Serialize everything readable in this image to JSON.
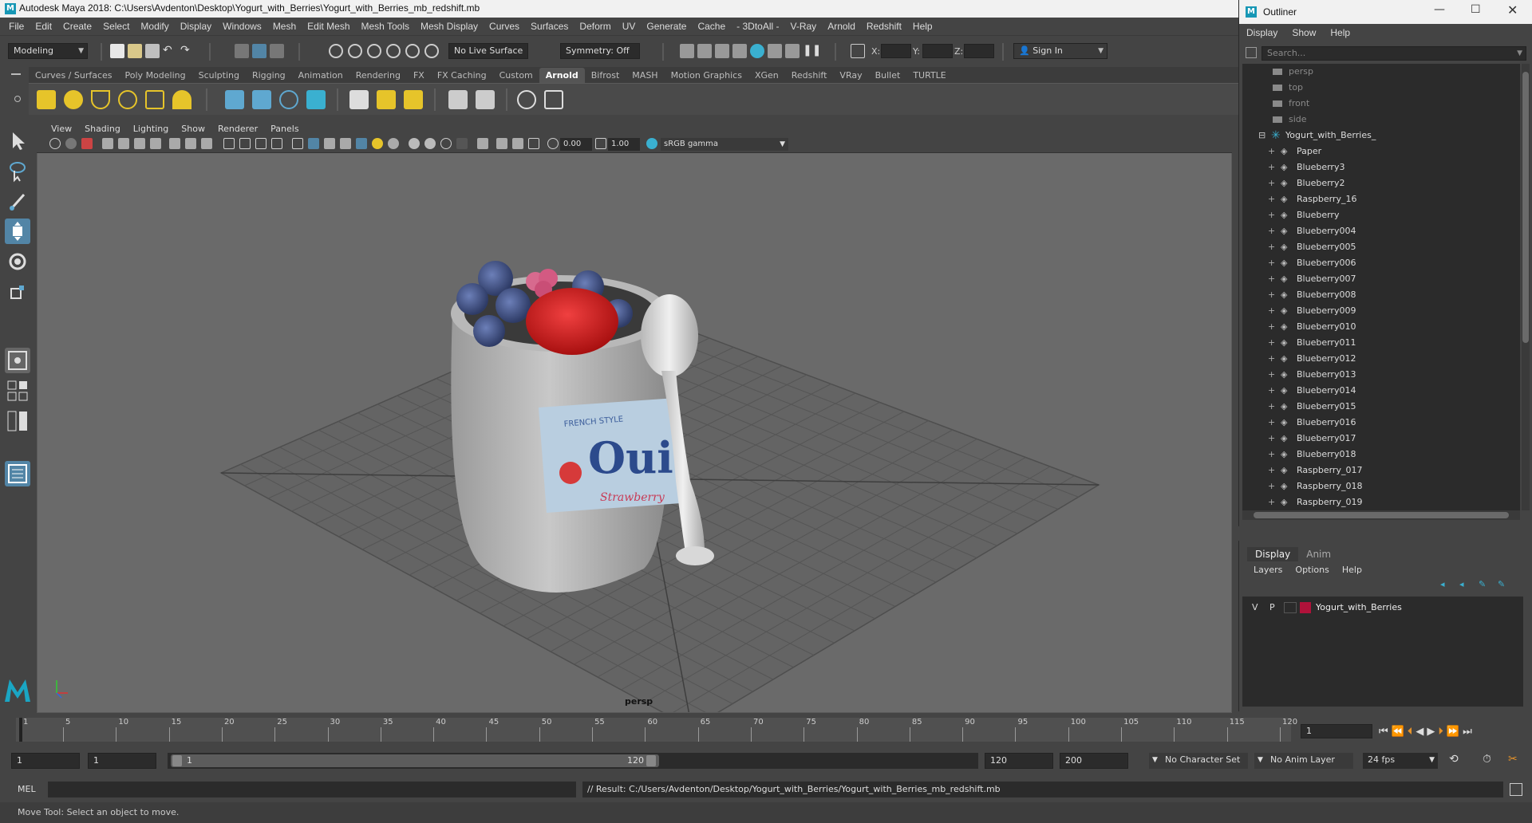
{
  "window": {
    "title": "Autodesk Maya 2018: C:\\Users\\Avdenton\\Desktop\\Yogurt_with_Berries\\Yogurt_with_Berries_mb_redshift.mb"
  },
  "menubar": [
    "File",
    "Edit",
    "Create",
    "Select",
    "Modify",
    "Display",
    "Windows",
    "Mesh",
    "Edit Mesh",
    "Mesh Tools",
    "Mesh Display",
    "Curves",
    "Surfaces",
    "Deform",
    "UV",
    "Generate",
    "Cache",
    "- 3DtoAll -",
    "V-Ray",
    "Arnold",
    "Redshift",
    "Help"
  ],
  "statusline": {
    "mode": "Modeling",
    "live_surface": "No Live Surface",
    "symmetry": "Symmetry: Off",
    "x_label": "X:",
    "y_label": "Y:",
    "z_label": "Z:",
    "sign_in": "Sign In"
  },
  "shelf": {
    "tabs": [
      "Curves / Surfaces",
      "Poly Modeling",
      "Sculpting",
      "Rigging",
      "Animation",
      "Rendering",
      "FX",
      "FX Caching",
      "Custom",
      "Arnold",
      "Bifrost",
      "MASH",
      "Motion Graphics",
      "XGen",
      "Redshift",
      "VRay",
      "Bullet",
      "TURTLE"
    ],
    "active_tab": "Arnold"
  },
  "viewport": {
    "menu": [
      "View",
      "Shading",
      "Lighting",
      "Show",
      "Renderer",
      "Panels"
    ],
    "exposure": "0.00",
    "gamma": "1.00",
    "color_space": "sRGB gamma",
    "camera_label": "persp"
  },
  "outliner": {
    "title": "Outliner",
    "menu": [
      "Display",
      "Show",
      "Help"
    ],
    "search_placeholder": "Search...",
    "cameras": [
      "persp",
      "top",
      "front",
      "side"
    ],
    "group": "Yogurt_with_Berries_",
    "items": [
      "Paper",
      "Blueberry3",
      "Blueberry2",
      "Raspberry_16",
      "Blueberry",
      "Blueberry004",
      "Blueberry005",
      "Blueberry006",
      "Blueberry007",
      "Blueberry008",
      "Blueberry009",
      "Blueberry010",
      "Blueberry011",
      "Blueberry012",
      "Blueberry013",
      "Blueberry014",
      "Blueberry015",
      "Blueberry016",
      "Blueberry017",
      "Blueberry018",
      "Raspberry_017",
      "Raspberry_018",
      "Raspberry_019"
    ]
  },
  "layers": {
    "tabs": [
      "Display",
      "Anim"
    ],
    "menu": [
      "Layers",
      "Options",
      "Help"
    ],
    "layer": {
      "v": "V",
      "p": "P",
      "name": "Yogurt_with_Berries",
      "color": "#b0123a"
    }
  },
  "timeline": {
    "ticks": [
      "1",
      "5",
      "10",
      "15",
      "20",
      "25",
      "30",
      "35",
      "40",
      "45",
      "50",
      "55",
      "60",
      "65",
      "70",
      "75",
      "80",
      "85",
      "90",
      "95",
      "100",
      "105",
      "110",
      "115",
      "120"
    ],
    "current_frame": "1"
  },
  "range": {
    "start": "1",
    "inner_start": "1",
    "range_start": "1",
    "range_end": "120",
    "end": "120",
    "max": "200",
    "character_set": "No Character Set",
    "anim_layer": "No Anim Layer",
    "fps": "24 fps"
  },
  "command": {
    "lang": "MEL",
    "result": "// Result: C:/Users/Avdenton/Desktop/Yogurt_with_Berries/Yogurt_with_Berries_mb_redshift.mb"
  },
  "help_line": "Move Tool: Select an object to move.",
  "colors": {
    "accent": "#5285a6",
    "viewport_bg": "#6a6a6a",
    "panel": "#444444"
  }
}
